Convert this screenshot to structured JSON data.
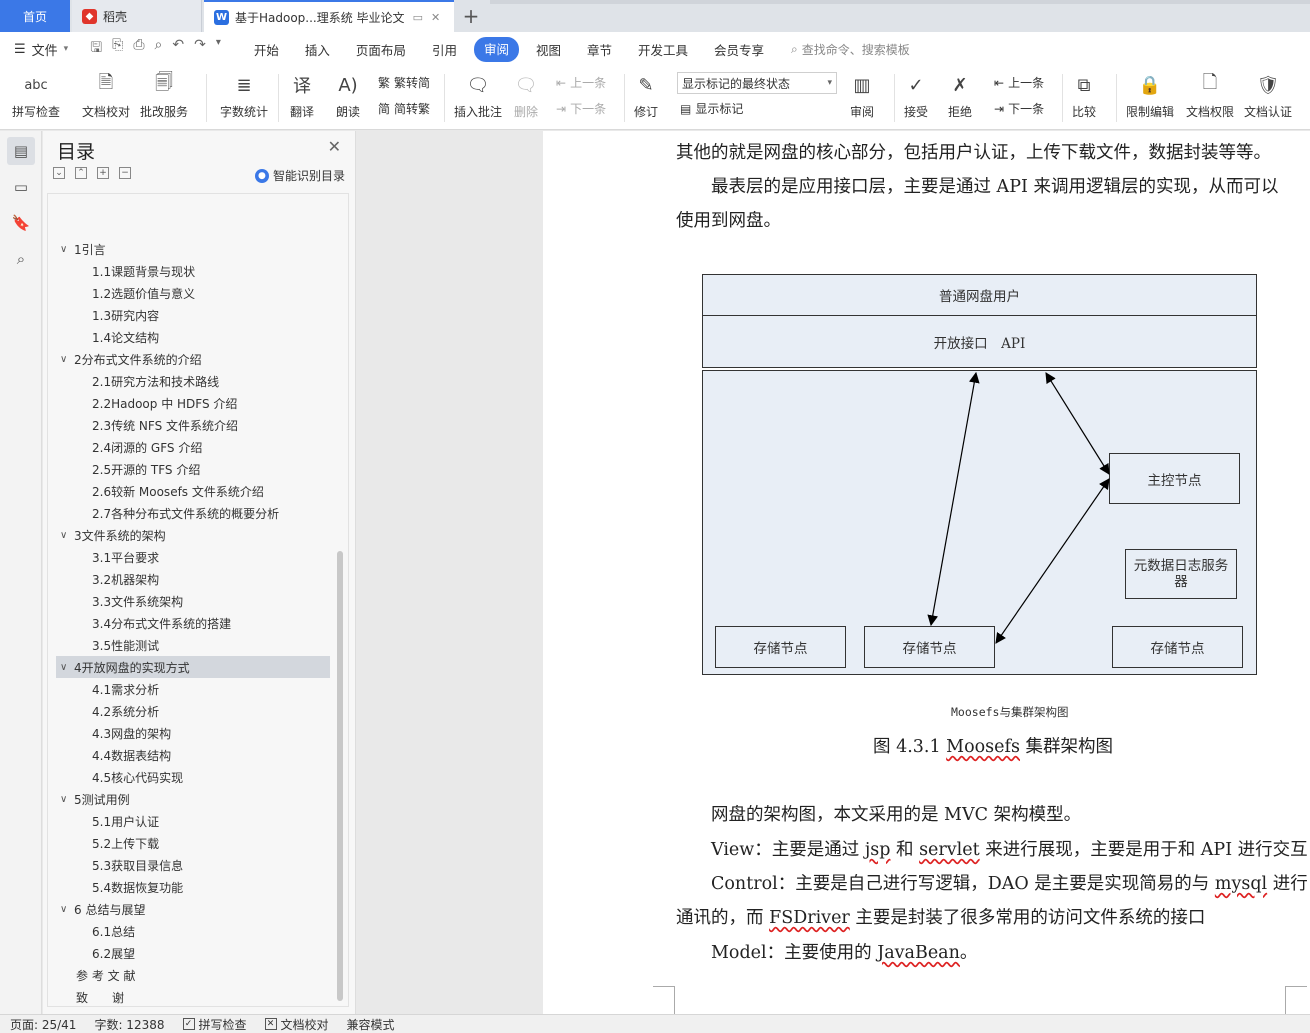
{
  "tabs": {
    "home": "首页",
    "t1": "稻壳",
    "t2": "基于Hadoop...理系统 毕业论文",
    "add": "+"
  },
  "menubar": {
    "file": "文件",
    "items": [
      "开始",
      "插入",
      "页面布局",
      "引用",
      "审阅",
      "视图",
      "章节",
      "开发工具",
      "会员专享"
    ],
    "active": "审阅",
    "search": "查找命令、搜索模板"
  },
  "ribbon": {
    "spell": "拼写检查",
    "doc_proof": "文档校对",
    "batch": "批改服务",
    "word_count": "字数统计",
    "translate": "翻译",
    "read": "朗读",
    "trad_to_simp": "繁转简",
    "simp_to_trad": "简转繁",
    "insert_comment": "插入批注",
    "delete": "删除",
    "prev": "上一条",
    "next": "下一条",
    "revise": "修订",
    "markup_state": "显示标记的最终状态",
    "show_markup": "显示标记",
    "review": "审阅",
    "accept": "接受",
    "reject": "拒绝",
    "prev2": "上一条",
    "next2": "下一条",
    "compare": "比较",
    "restrict": "限制编辑",
    "permission": "文档权限",
    "cert": "文档认证"
  },
  "toc": {
    "title": "目录",
    "smart": "智能识别目录",
    "items": [
      {
        "text": "1引言",
        "level": 1,
        "expand": true
      },
      {
        "text": "1.1课题背景与现状",
        "level": 2
      },
      {
        "text": "1.2选题价值与意义",
        "level": 2
      },
      {
        "text": "1.3研究内容",
        "level": 2
      },
      {
        "text": "1.4论文结构",
        "level": 2
      },
      {
        "text": "2分布式文件系统的介绍",
        "level": 1,
        "expand": true
      },
      {
        "text": "2.1研究方法和技术路线",
        "level": 2
      },
      {
        "text": "2.2Hadoop 中 HDFS 介绍",
        "level": 2
      },
      {
        "text": "2.3传统 NFS 文件系统介绍",
        "level": 2
      },
      {
        "text": "2.4闭源的 GFS 介绍",
        "level": 2
      },
      {
        "text": "2.5开源的 TFS 介绍",
        "level": 2
      },
      {
        "text": "2.6较新 Moosefs 文件系统介绍",
        "level": 2
      },
      {
        "text": "2.7各种分布式文件系统的概要分析",
        "level": 2
      },
      {
        "text": "3文件系统的架构",
        "level": 1,
        "expand": true
      },
      {
        "text": "3.1平台要求",
        "level": 2
      },
      {
        "text": "3.2机器架构",
        "level": 2
      },
      {
        "text": "3.3文件系统架构",
        "level": 2
      },
      {
        "text": "3.4分布式文件系统的搭建",
        "level": 2
      },
      {
        "text": "3.5性能测试",
        "level": 2
      },
      {
        "text": "4开放网盘的实现方式",
        "level": 1,
        "expand": true,
        "selected": true
      },
      {
        "text": "4.1需求分析",
        "level": 2
      },
      {
        "text": "4.2系统分析",
        "level": 2
      },
      {
        "text": "4.3网盘的架构",
        "level": 2
      },
      {
        "text": "4.4数据表结构",
        "level": 2
      },
      {
        "text": "4.5核心代码实现",
        "level": 2
      },
      {
        "text": "5测试用例",
        "level": 1,
        "expand": true
      },
      {
        "text": "5.1用户认证",
        "level": 2
      },
      {
        "text": "5.2上传下载",
        "level": 2
      },
      {
        "text": "5.3获取目录信息",
        "level": 2
      },
      {
        "text": "5.4数据恢复功能",
        "level": 2
      },
      {
        "text": "6 总结与展望",
        "level": 1,
        "expand": true
      },
      {
        "text": "6.1总结",
        "level": 2
      },
      {
        "text": "6.2展望",
        "level": 2
      },
      {
        "text": "参 考 文 献",
        "level": 0
      },
      {
        "text": "致　　谢",
        "level": 0
      }
    ]
  },
  "doc": {
    "p1": "其他的就是网盘的核心部分，包括用户认证，上传下载文件，数据封装等等。",
    "p2a": "最表层的是应用接口层，主要是通过 API 来调用逻辑层的实现，从而可以",
    "p2b": "使用到网盘。",
    "diagram": {
      "user": "普通网盘用户",
      "api": "开放接口　API",
      "master": "主控节点",
      "metalog": "元数据日志服务器",
      "storage1": "存储节点",
      "storage2": "存储节点",
      "storage3": "存储节点",
      "small_caption": "Moosefs与集群架构图"
    },
    "fig_prefix": "图  4.3.1 ",
    "fig_word": "Moosefs",
    "fig_suffix": " 集群架构图",
    "p3": "网盘的架构图，本文采用的是 MVC 架构模型。",
    "p4_a": "View：主要是通过 ",
    "p4_jsp": "jsp",
    "p4_b": "  和 ",
    "p4_servlet": "servlet",
    "p4_c": " 来进行展现，主要是用于和 API 进行交互",
    "p5_a": "Control：主要是自己进行写逻辑，DAO 是主要是实现简易的与 ",
    "p5_mysql": "mysql",
    "p5_b": " 进行",
    "p6_a": "通讯的，而 ",
    "p6_fs": "FSDriver",
    "p6_b": " 主要是封装了很多常用的访问文件系统的接口",
    "p7_a": "Model：主要使用的 ",
    "p7_jb": "JavaBean",
    "p7_b": "。"
  },
  "status": {
    "page": "页面: 25/41",
    "words": "字数: 12388",
    "spell": "拼写检查",
    "proof": "文档校对",
    "compat": "兼容模式"
  }
}
